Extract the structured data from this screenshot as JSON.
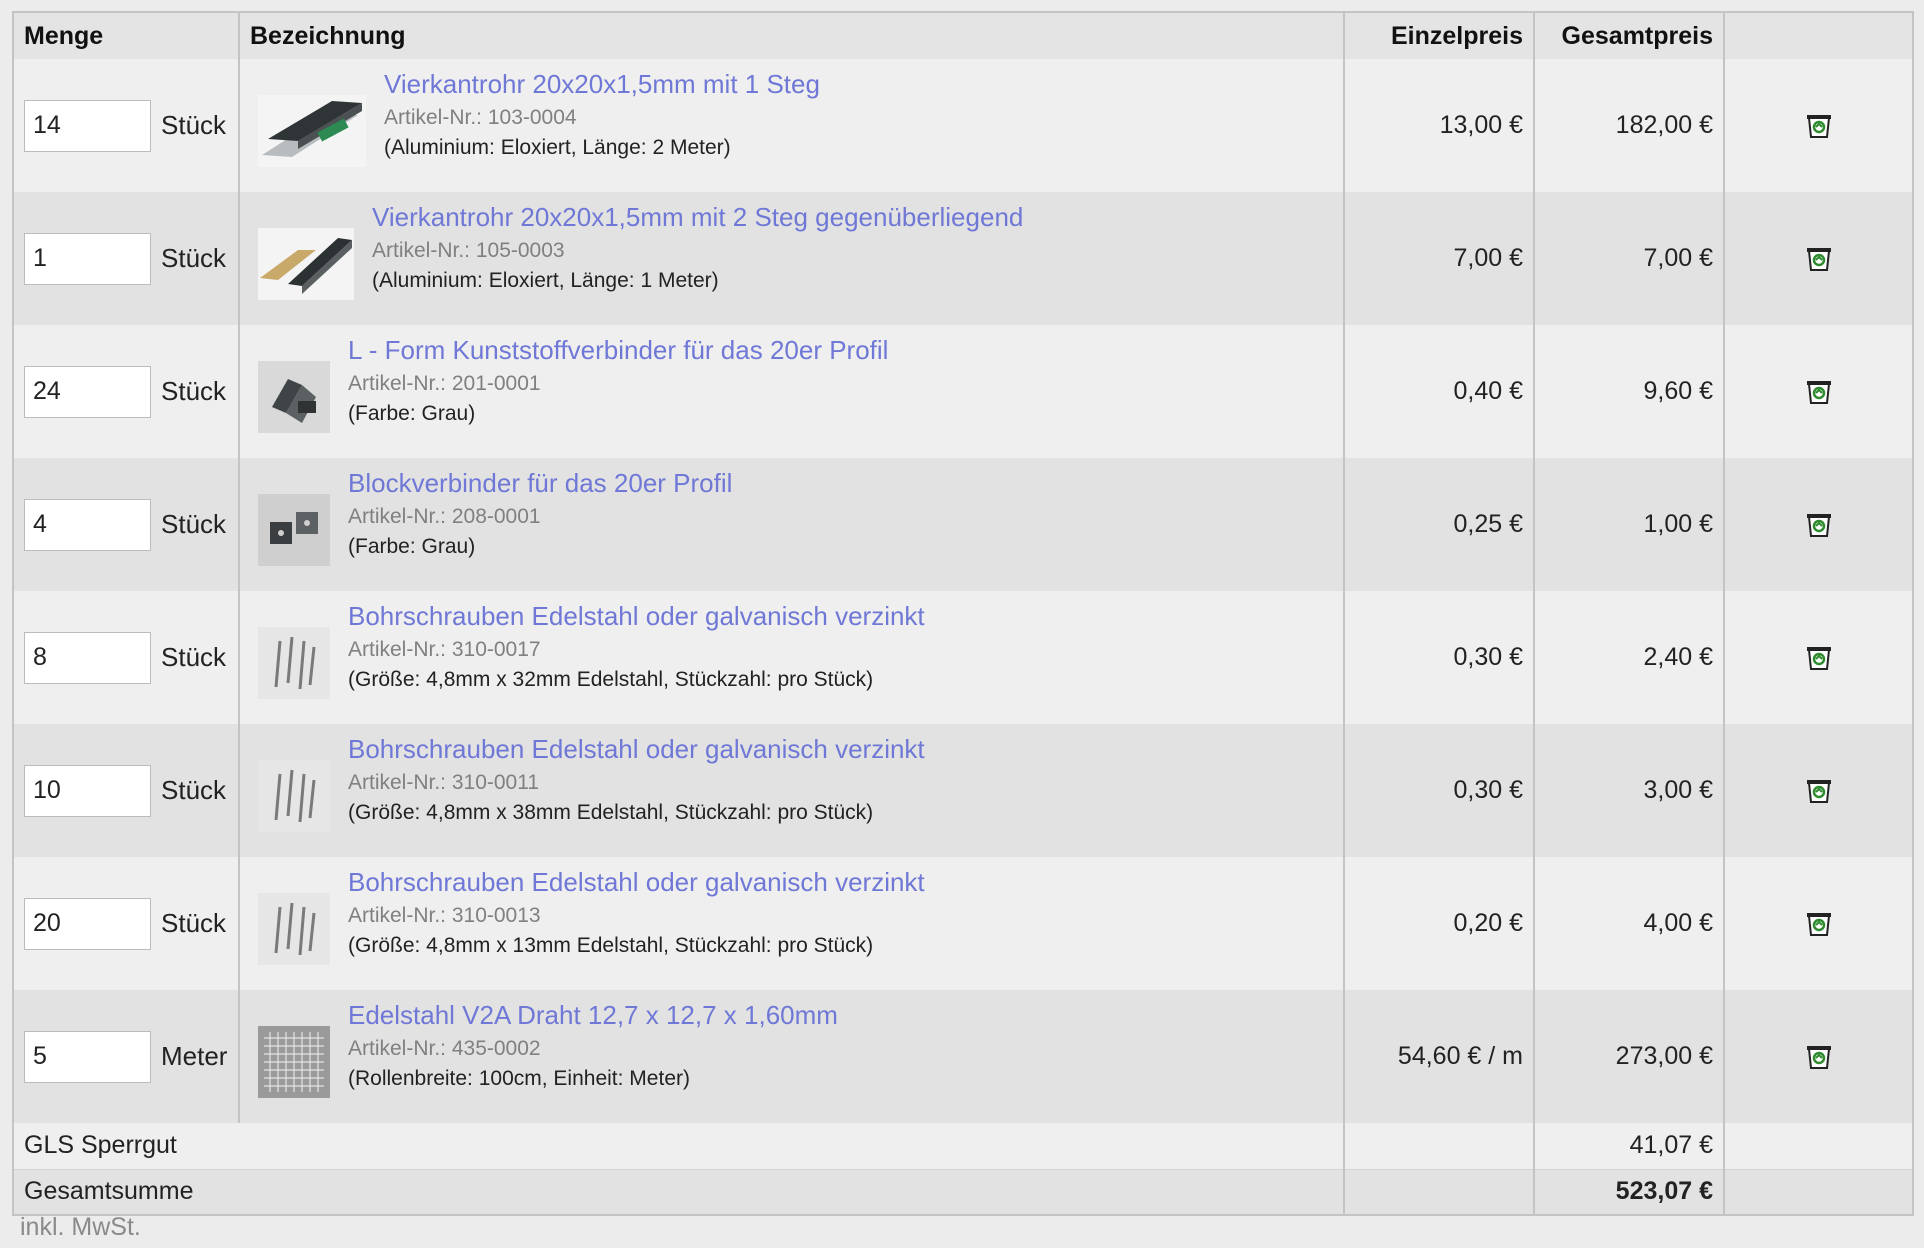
{
  "header": {
    "menge": "Menge",
    "bezeichnung": "Bezeichnung",
    "einzelpreis": "Einzelpreis",
    "gesamtpreis": "Gesamtpreis"
  },
  "items": [
    {
      "qty": "14",
      "unit": "Stück",
      "name": "Vierkantrohr 20x20x1,5mm mit 1 Steg",
      "art": "Artikel-Nr.: 103-0004",
      "attr": "(Aluminium: Eloxiert, Länge: 2 Meter)",
      "einzel": "13,00 €",
      "gesamt": "182,00 €"
    },
    {
      "qty": "1",
      "unit": "Stück",
      "name": "Vierkantrohr 20x20x1,5mm mit 2 Steg gegenüberliegend",
      "art": "Artikel-Nr.: 105-0003",
      "attr": "(Aluminium: Eloxiert, Länge: 1 Meter)",
      "einzel": "7,00 €",
      "gesamt": "7,00 €"
    },
    {
      "qty": "24",
      "unit": "Stück",
      "name": "L - Form Kunststoffverbinder für das 20er Profil",
      "art": "Artikel-Nr.: 201-0001",
      "attr": "(Farbe: Grau)",
      "einzel": "0,40 €",
      "gesamt": "9,60 €"
    },
    {
      "qty": "4",
      "unit": "Stück",
      "name": "Blockverbinder für das 20er Profil",
      "art": "Artikel-Nr.: 208-0001",
      "attr": "(Farbe: Grau)",
      "einzel": "0,25 €",
      "gesamt": "1,00 €"
    },
    {
      "qty": "8",
      "unit": "Stück",
      "name": "Bohrschrauben Edelstahl oder galvanisch verzinkt",
      "art": "Artikel-Nr.: 310-0017",
      "attr": "(Größe: 4,8mm x 32mm Edelstahl, Stückzahl: pro Stück)",
      "einzel": "0,30 €",
      "gesamt": "2,40 €"
    },
    {
      "qty": "10",
      "unit": "Stück",
      "name": "Bohrschrauben Edelstahl oder galvanisch verzinkt",
      "art": "Artikel-Nr.: 310-0011",
      "attr": "(Größe: 4,8mm x 38mm Edelstahl, Stückzahl: pro Stück)",
      "einzel": "0,30 €",
      "gesamt": "3,00 €"
    },
    {
      "qty": "20",
      "unit": "Stück",
      "name": "Bohrschrauben Edelstahl oder galvanisch verzinkt",
      "art": "Artikel-Nr.: 310-0013",
      "attr": "(Größe: 4,8mm x 13mm Edelstahl, Stückzahl: pro Stück)",
      "einzel": "0,20 €",
      "gesamt": "4,00 €"
    },
    {
      "qty": "5",
      "unit": "Meter",
      "name": "Edelstahl V2A Draht 12,7 x 12,7 x 1,60mm",
      "art": "Artikel-Nr.: 435-0002",
      "attr": "(Rollenbreite: 100cm, Einheit: Meter)",
      "einzel": "54,60 € / m",
      "gesamt": "273,00 €"
    }
  ],
  "shipping": {
    "label": "GLS Sperrgut",
    "value": "41,07 €"
  },
  "total": {
    "label": "Gesamtsumme",
    "value": "523,07 €"
  },
  "tax_note": "inkl. MwSt.",
  "colors": {
    "link": "#6f78d6",
    "border": "#c4c4c4",
    "trash_icon": "#2e8b2e"
  }
}
